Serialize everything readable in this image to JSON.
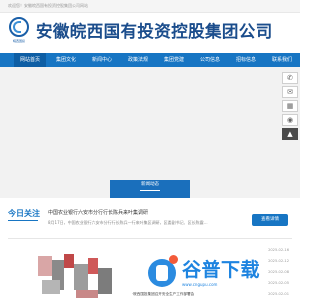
{
  "topbar": {
    "welcome": "欢迎您！安徽皖西国有投资控股集团公司网站"
  },
  "header": {
    "logo_tag": "皖西国投",
    "company_name": "安徽皖西国有投资控股集团公司"
  },
  "nav": {
    "items": [
      {
        "label": "网站首页",
        "active": true
      },
      {
        "label": "集团文化",
        "active": false
      },
      {
        "label": "新闻中心",
        "active": false
      },
      {
        "label": "政策法规",
        "active": false
      },
      {
        "label": "集团党建",
        "active": false
      },
      {
        "label": "公司信息",
        "active": false
      },
      {
        "label": "招标信息",
        "active": false
      },
      {
        "label": "联系我们",
        "active": false
      }
    ]
  },
  "side_icons": [
    "phone-icon",
    "chat-icon",
    "qrcode-icon",
    "weibo-icon",
    "top-icon"
  ],
  "banner_box": {
    "title": "新闻动态"
  },
  "today": {
    "badge": "今日关注",
    "headline": "中国农业银行六安市分行行长陈兵来叶集调研",
    "summary": "8月17日，中国农业银行六安市分行行长陈兵一行来叶集区调研，区委副书记、区长陈震…",
    "more_label": "查看详情"
  },
  "news": [
    {
      "title": "",
      "date": "2025-02-16"
    },
    {
      "title": "",
      "date": "2025-02-12"
    },
    {
      "title": "",
      "date": "2025-02-08"
    },
    {
      "title": "",
      "date": "2025-02-05"
    },
    {
      "title": "·皖西国投集团召开安全生产工作部署会",
      "date": "2025-02-01"
    }
  ],
  "watermark": {
    "text": "谷普下载",
    "sub": "www.cngupu.com"
  },
  "colors": {
    "brand_blue": "#1775c3",
    "title_blue": "#1b4d8c"
  }
}
